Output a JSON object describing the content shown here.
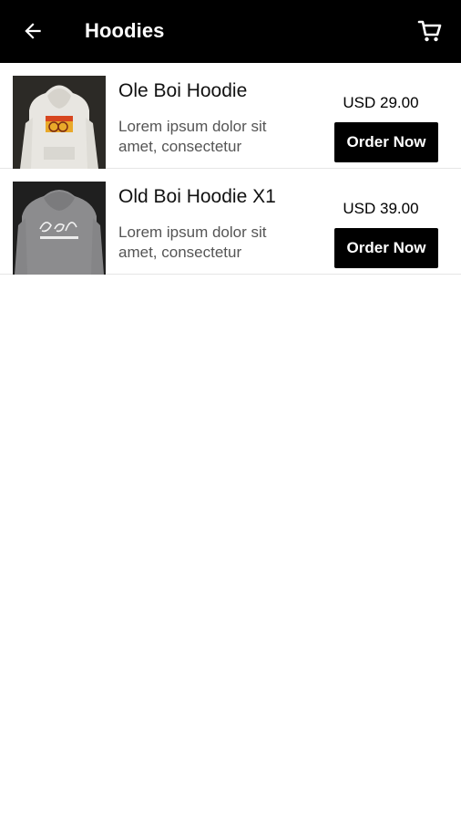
{
  "header": {
    "title": "Hoodies",
    "back_icon": "arrow-left-icon",
    "cart_icon": "shopping-cart-icon",
    "background": "#000000",
    "foreground": "#ffffff"
  },
  "products": [
    {
      "name": "Ole Boi Hoodie",
      "description": "Lorem ipsum dolor sit amet, consectetur",
      "price": "USD 29.00",
      "order_label": "Order Now"
    },
    {
      "name": "Old Boi Hoodie X1",
      "description": "Lorem ipsum dolor sit amet, consectetur",
      "price": "USD 39.00",
      "order_label": "Order Now"
    }
  ]
}
